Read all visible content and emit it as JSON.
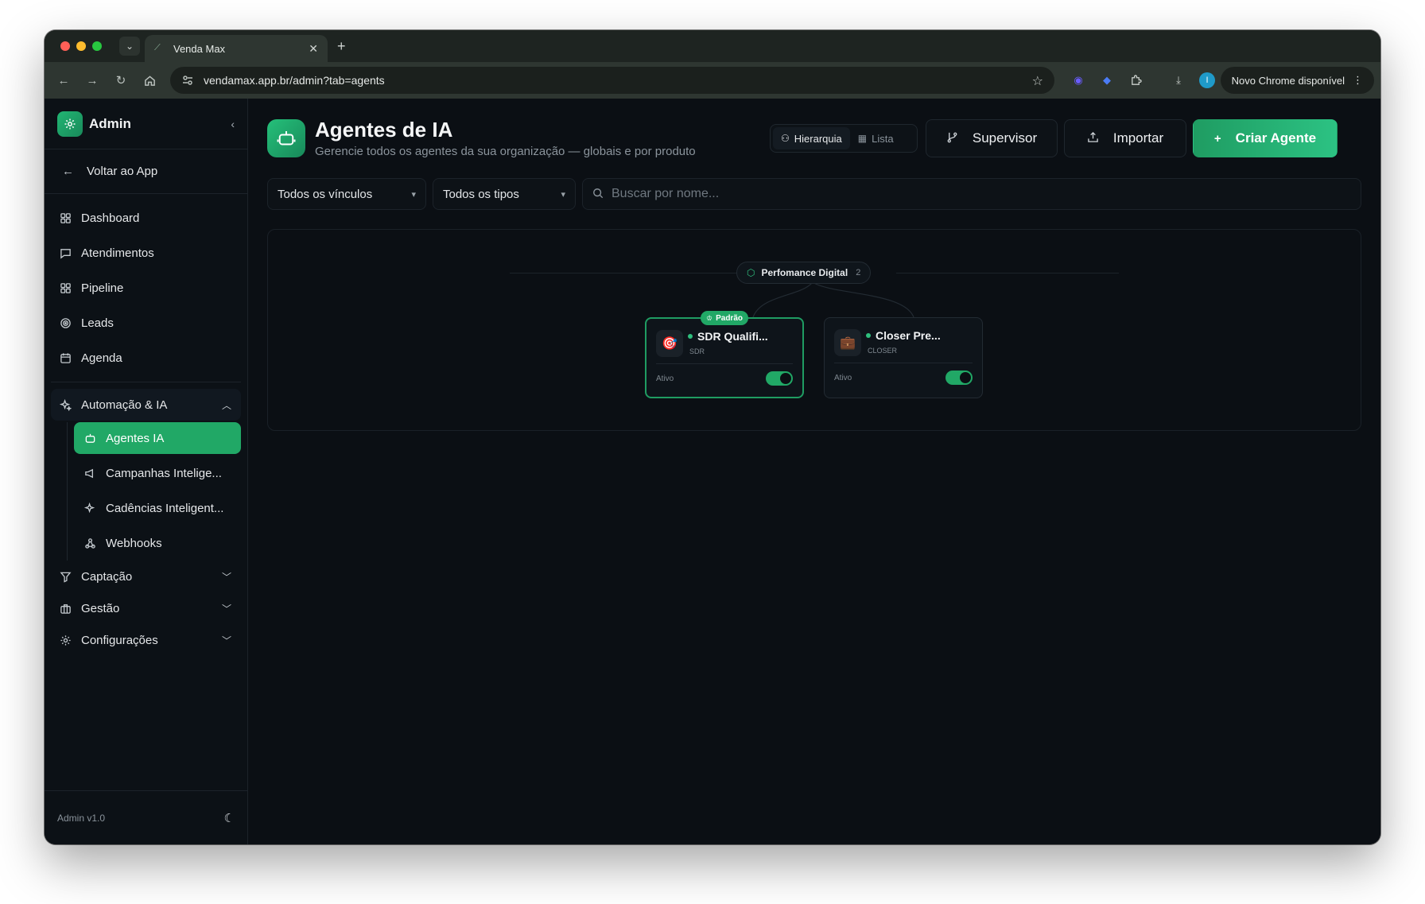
{
  "browser": {
    "tab_title": "Venda Max",
    "url": "vendamax.app.br/admin?tab=agents",
    "update_label": "Novo Chrome disponível",
    "profile_initial": "I"
  },
  "sidebar": {
    "title": "Admin",
    "back_label": "Voltar ao App",
    "items": [
      {
        "label": "Dashboard",
        "icon": "grid-icon"
      },
      {
        "label": "Atendimentos",
        "icon": "chat-icon"
      },
      {
        "label": "Pipeline",
        "icon": "kanban-icon"
      },
      {
        "label": "Leads",
        "icon": "target-icon"
      },
      {
        "label": "Agenda",
        "icon": "calendar-icon"
      }
    ],
    "group_automation": {
      "label": "Automação & IA",
      "items": [
        {
          "label": "Agentes IA",
          "icon": "robot-icon",
          "active": true
        },
        {
          "label": "Campanhas Intelige...",
          "icon": "megaphone-icon"
        },
        {
          "label": "Cadências Inteligent...",
          "icon": "sparkle-icon"
        },
        {
          "label": "Webhooks",
          "icon": "webhook-icon"
        }
      ]
    },
    "groups_collapsed": [
      {
        "label": "Captação",
        "icon": "funnel-icon"
      },
      {
        "label": "Gestão",
        "icon": "briefcase-icon"
      },
      {
        "label": "Configurações",
        "icon": "gear-icon"
      }
    ],
    "footer_version": "Admin v1.0"
  },
  "header": {
    "title": "Agentes de IA",
    "subtitle": "Gerencie todos os agentes da sua organização — globais e por produto",
    "view_hierarchy": "Hierarquia",
    "view_list": "Lista",
    "supervisor_label": "Supervisor",
    "import_label": "Importar",
    "create_label": "Criar Agente"
  },
  "filters": {
    "link_filter": "Todos os vínculos",
    "type_filter": "Todos os tipos",
    "search_placeholder": "Buscar por nome..."
  },
  "hierarchy": {
    "product_name": "Perfomance Digital",
    "product_count": "2",
    "agents": [
      {
        "name": "SDR Qualifi...",
        "role": "SDR",
        "status": "Ativo",
        "badge": "Padrão",
        "avatar": "🎯",
        "enabled": true
      },
      {
        "name": "Closer Pre...",
        "role": "CLOSER",
        "status": "Ativo",
        "avatar": "💼",
        "enabled": true
      }
    ]
  },
  "colors": {
    "accent": "#21a866",
    "background": "#0b0f14"
  }
}
